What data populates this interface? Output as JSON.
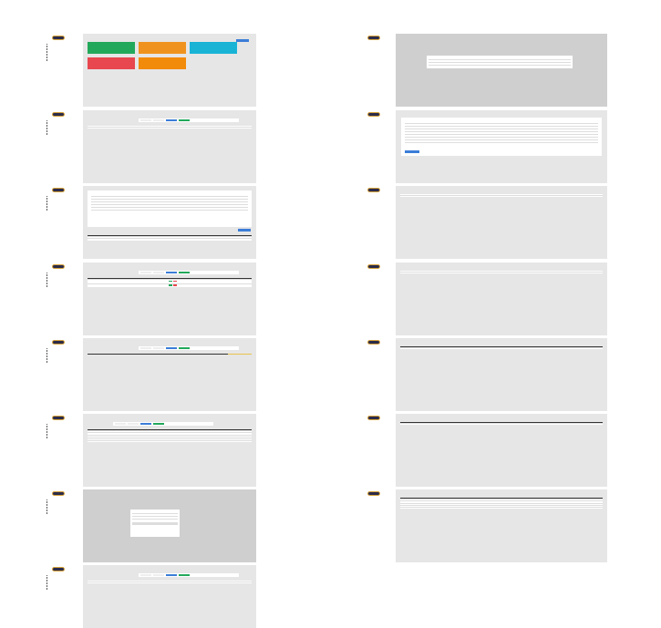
{
  "colors": {
    "green": "#22a85a",
    "orange": "#f0931e",
    "cyan": "#19b3d6",
    "red": "#e8474f",
    "orange2": "#f28a0a",
    "blue": "#3b7dd8",
    "yellow": "#e8c34a",
    "dark_header": "#333333"
  },
  "icons": [
    "logo-icon",
    "nav-bullet-icon"
  ],
  "screens": [
    {
      "id": "s1",
      "title": "",
      "kind": "dashboard"
    },
    {
      "id": "s2",
      "title": "",
      "kind": "list"
    },
    {
      "id": "s3",
      "title": "",
      "kind": "form-list"
    },
    {
      "id": "s4",
      "title": "",
      "kind": "list-actions"
    },
    {
      "id": "s5",
      "title": "",
      "kind": "list-yellow"
    },
    {
      "id": "s6",
      "title": "",
      "kind": "list-rows"
    },
    {
      "id": "s7",
      "title": "",
      "kind": "modal"
    },
    {
      "id": "s8",
      "title": "",
      "kind": "list"
    },
    {
      "id": "r1",
      "title": "",
      "kind": "modal-wide"
    },
    {
      "id": "r2",
      "title": "",
      "kind": "form"
    },
    {
      "id": "r3",
      "title": "",
      "kind": "list-small"
    },
    {
      "id": "r4",
      "title": "",
      "kind": "list-small"
    },
    {
      "id": "r5",
      "title": "",
      "kind": "dark-table"
    },
    {
      "id": "r6",
      "title": "",
      "kind": "dark-table"
    },
    {
      "id": "r7",
      "title": "",
      "kind": "dark-rows"
    }
  ]
}
